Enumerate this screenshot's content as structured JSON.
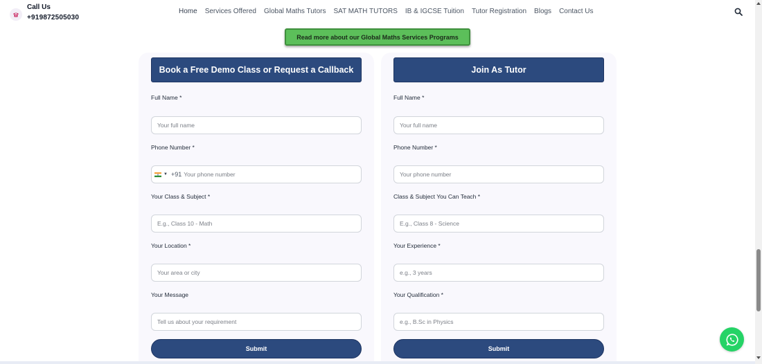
{
  "header": {
    "call_title": "Call Us",
    "call_number": "+919872505030",
    "nav": [
      "Home",
      "Services Offered",
      "Global Maths Tutors",
      "SAT MATH TUTORS",
      "IB & IGCSE Tuition",
      "Tutor Registration",
      "Blogs",
      "Contact Us"
    ]
  },
  "promo": {
    "label": "Read more about our Global Maths Services Programs",
    "color": "#5cbf5a"
  },
  "demo_form": {
    "heading": "Book a Free Demo Class or Request a Callback",
    "fields": [
      {
        "label": "Full Name *",
        "placeholder": "Your full name"
      },
      {
        "label": "Phone Number *",
        "dial_code": "+91",
        "placeholder": "Your phone number",
        "flag": "india-flag-icon"
      },
      {
        "label": "Your Class & Subject *",
        "placeholder": "E.g., Class 10 - Math"
      },
      {
        "label": "Your Location *",
        "placeholder": "Your area or city"
      },
      {
        "label": "Your Message",
        "placeholder": "Tell us about your requirement"
      }
    ],
    "submit_label": "Submit"
  },
  "tutor_form": {
    "heading": "Join As Tutor",
    "fields": [
      {
        "label": "Full Name *",
        "placeholder": "Your full name"
      },
      {
        "label": "Phone Number *",
        "placeholder": "Your phone number"
      },
      {
        "label": "Class & Subject You Can Teach *",
        "placeholder": "E.g., Class 8 - Science"
      },
      {
        "label": "Your Experience *",
        "placeholder": "e.g., 3 years"
      },
      {
        "label": "Your Qualification *",
        "placeholder": "e.g., B.Sc in Physics"
      }
    ],
    "submit_label": "Submit"
  },
  "colors": {
    "brand_navy": "#2c4a7e",
    "card_bg": "#f9f8fd",
    "whatsapp_green": "#25d366"
  },
  "icons": {
    "call": "phone-icon",
    "search": "search-icon",
    "whatsapp": "whatsapp-icon"
  }
}
